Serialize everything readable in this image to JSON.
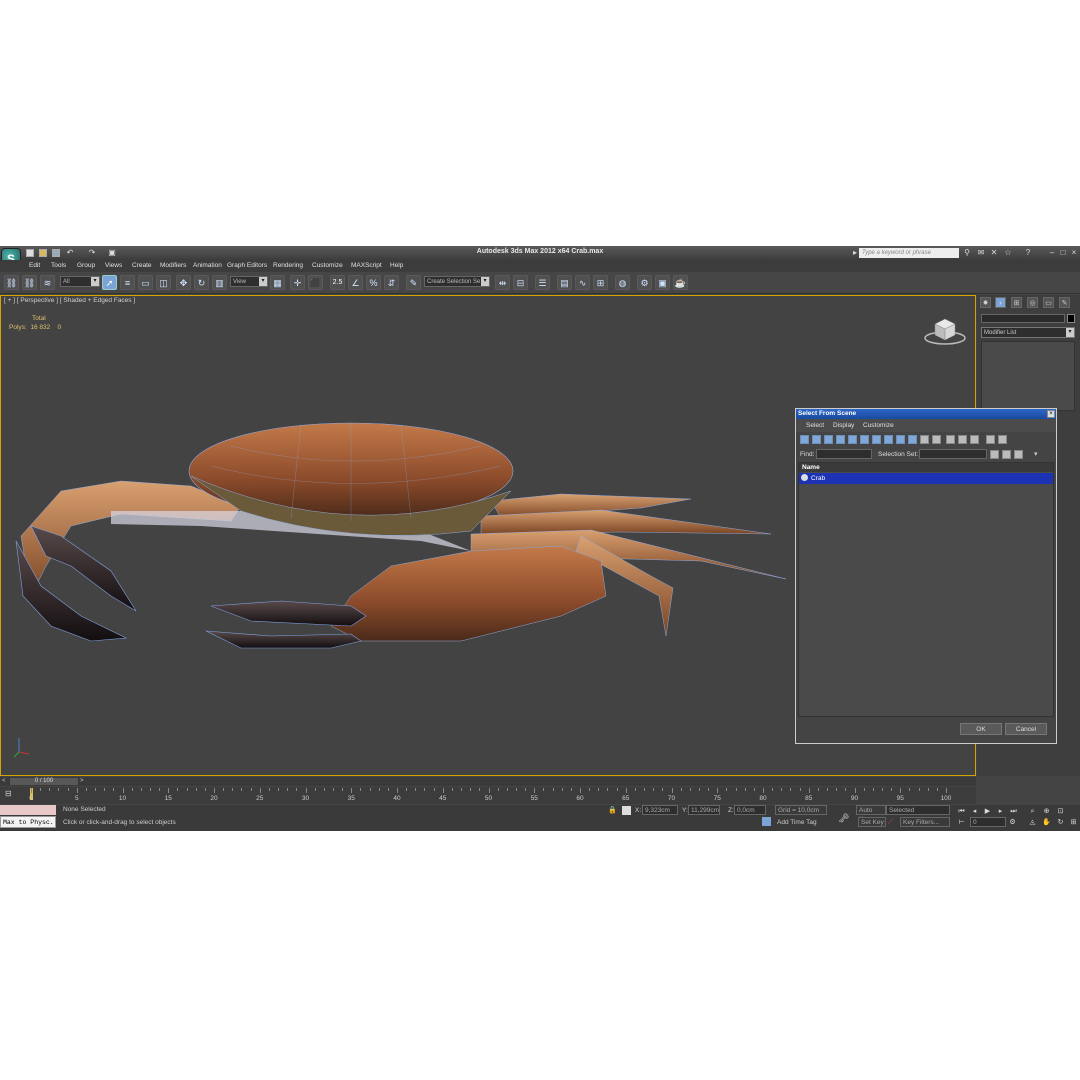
{
  "app": {
    "title": "Autodesk 3ds Max  2012 x64      Crab.max",
    "search_placeholder": "Type a keyword or phrase"
  },
  "menu": [
    "Edit",
    "Tools",
    "Group",
    "Views",
    "Create",
    "Modifiers",
    "Animation",
    "Graph Editors",
    "Rendering",
    "Customize",
    "MAXScript",
    "Help"
  ],
  "toolbar": {
    "selection_filter": "All",
    "reference_coord": "View",
    "snap_value": "2.5",
    "named_selection": "Create Selection Se"
  },
  "viewport": {
    "label": "[ + ] [ Perspective ] [ Shaded + Edged Faces ]",
    "stats_header": "Total",
    "polys_label": "Polys:",
    "polys_value": "16 832",
    "polys_selected": "0"
  },
  "command_panel": {
    "modifier_list": "Modifier List"
  },
  "dialog": {
    "title": "Select From Scene",
    "menu": [
      "Select",
      "Display",
      "Customize"
    ],
    "find_label": "Find:",
    "selection_set_label": "Selection Set:",
    "column_name": "Name",
    "rows": [
      "Crab"
    ],
    "ok": "OK",
    "cancel": "Cancel"
  },
  "timeline": {
    "frame_counter": "0 / 100",
    "ticks": [
      "0",
      "5",
      "10",
      "15",
      "20",
      "25",
      "30",
      "35",
      "40",
      "45",
      "50",
      "55",
      "60",
      "65",
      "70",
      "75",
      "80",
      "85",
      "90",
      "95",
      "100"
    ]
  },
  "status": {
    "maxscript": "Max to Physc.",
    "selection": "None Selected",
    "prompt": "Click or click-and-drag to select objects",
    "x_label": "X:",
    "x_value": "9,323cm",
    "y_label": "Y:",
    "y_value": "11,299cm",
    "z_label": "Z:",
    "z_value": "0,0cm",
    "grid": "Grid = 10,0cm",
    "add_time_tag": "Add Time Tag",
    "auto_key": "Auto Key",
    "set_key": "Set Key",
    "key_mode": "Selected",
    "key_filters": "Key Filters...",
    "current_frame": "0"
  }
}
